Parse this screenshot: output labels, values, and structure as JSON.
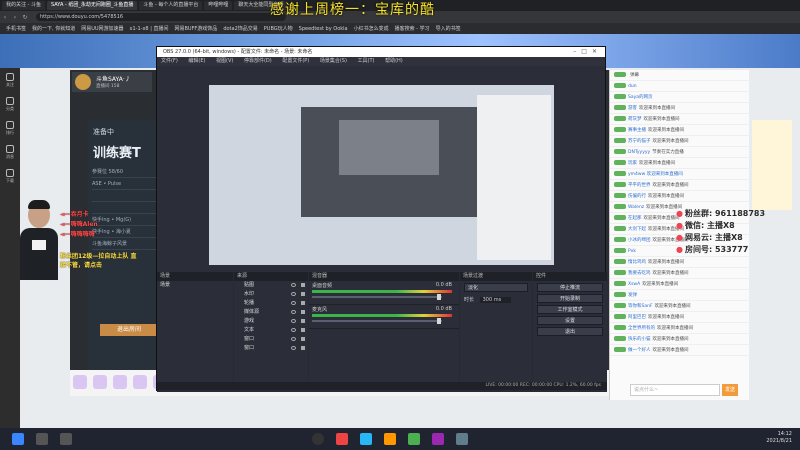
{
  "browser": {
    "tabs": [
      "我的关注 - 斗鱼",
      "SAYA - 纸团_永劫无间跑圈_斗鱼直播",
      "斗鱼 - 每个人的直播平台",
      "哔哩哔哩",
      "聊天大全能同型音频"
    ],
    "url": "https://www.douyu.com/5478516",
    "bookmarks": [
      "手机书签",
      "我的一下, 你就知道",
      "网易UU网游加速器",
      "x1-1-x8 | 直播间",
      "网易BUFF游戏饰品",
      "dota2饰品交易",
      "PUBG玩人物",
      "Speedtest by Ookla",
      "小红书怎么变成",
      "播客搜索 - 学习",
      "导入的书签"
    ]
  },
  "overlay_title": "感谢上周榜一：宝库的酷",
  "left_rail": [
    "关注",
    "分类",
    "排行",
    "消息",
    "下载"
  ],
  "streamer": {
    "name": "斗鱼SAYA·丿",
    "room": "直播间 158"
  },
  "panel": {
    "status": "准备中",
    "title": "训练赛T",
    "rows": [
      "参赛位 58/60",
      "ASE • Pulse",
      "",
      "",
      "快手lng • Mg(G)",
      "快手lng • 海小夏",
      "斗鱼海鲸子风景"
    ],
    "exit_label": "退出房间"
  },
  "gift_lines": [
    "◄—吞月卡",
    "◄—嗨嗨Alen",
    "◄—嗨嗨嗨嗨"
  ],
  "warning_text": "粉丝团12级—拉自动上队 直接不管，请点击",
  "info_lines": [
    {
      "icon": "fan-icon",
      "text": "粉丝群: 961188783"
    },
    {
      "icon": "wechat-icon",
      "text": "微信: 主播X8"
    },
    {
      "icon": "netease-icon",
      "text": "网易云: 主播X8"
    },
    {
      "icon": "room-icon",
      "text": "房间号: 533777"
    }
  ],
  "chat": {
    "rows": [
      {
        "name": "",
        "text": "弹幕"
      },
      {
        "name": "dun",
        "text": ""
      },
      {
        "name": "Saya的网页",
        "text": ""
      },
      {
        "name": "游客",
        "text": "欢迎来到本直播间"
      },
      {
        "name": "荷灰梦",
        "text": "欢迎来到本直播间"
      },
      {
        "name": "赛事主播",
        "text": "欢迎来到本直播间"
      },
      {
        "name": "苏宁的猫子",
        "text": "欢迎来到本直播间"
      },
      {
        "name": "DNTyyyyy",
        "text": "节奏在实力直播"
      },
      {
        "name": "玩家",
        "text": "欢迎来到本直播间"
      },
      {
        "name": "ym4ww 欢迎来到本直播间",
        "text": ""
      },
      {
        "name": "平平的世界",
        "text": "欢迎来到本直播间"
      },
      {
        "name": "伤偏的行",
        "text": "欢迎来到本直播间"
      },
      {
        "name": "Walenz",
        "text": "欢迎来到本直播间"
      },
      {
        "name": "在起那",
        "text": "欢迎来到本直播间"
      },
      {
        "name": "大剑下起",
        "text": "欢迎来到本直播间"
      },
      {
        "name": "小冰的绵团",
        "text": "欢迎来到本直播间"
      },
      {
        "name": "Pxk",
        "text": ""
      },
      {
        "name": "惰比鸡鸡",
        "text": "欢迎来到本直播间"
      },
      {
        "name": "我要去吃鸡",
        "text": "欢迎来到本直播间"
      },
      {
        "name": "XswA",
        "text": "欢迎来到本直播间"
      },
      {
        "name": "发弹",
        "text": ""
      },
      {
        "name": "等你和SanF",
        "text": "欢迎来到本直播间"
      },
      {
        "name": "阿里巴巴",
        "text": "欢迎来到本直播间"
      },
      {
        "name": "全世界所有的",
        "text": "欢迎来到本直播间"
      },
      {
        "name": "快乐的小猫",
        "text": "欢迎来到本直播间"
      },
      {
        "name": "做一个好人",
        "text": "欢迎来到本直播间"
      }
    ],
    "input_placeholder": "说点什么~",
    "send_label": "发送"
  },
  "obs": {
    "title": "OBS 27.0.0 (64-bit, windows) - 配置文件: 未命名 - 场景: 未命名",
    "menu": [
      "文件(F)",
      "编辑(E)",
      "视图(V)",
      "停靠部件(D)",
      "配置文件(P)",
      "场景集合(S)",
      "工具(T)",
      "帮助(H)"
    ],
    "preview_title": "感谢上周榜一：宝库的酷",
    "scenes_header": "场景",
    "scenes": [
      "场景"
    ],
    "sources_header": "来源",
    "sources": [
      "贴图",
      "水印",
      "轮播",
      "媒体源",
      "游戏",
      "文本",
      "窗口",
      "窗口"
    ],
    "mixer_header": "混音器",
    "mixer": [
      {
        "name": "桌面音频",
        "db": "0.0 dB"
      },
      {
        "name": "麦克风",
        "db": "0.0 dB"
      }
    ],
    "transitions_header": "场景过渡",
    "transition": "淡化",
    "duration_label": "时长",
    "duration": "300 ms",
    "controls_header": "控件",
    "controls": [
      "停止推流",
      "开始录制",
      "工作室模式",
      "设置",
      "退出"
    ],
    "status": "LIVE: 00:00:00   REC: 00:00:00   CPU: 1.2%, 60.00 fps"
  },
  "clock": {
    "time": "14:12",
    "date": "2021/8/21"
  }
}
